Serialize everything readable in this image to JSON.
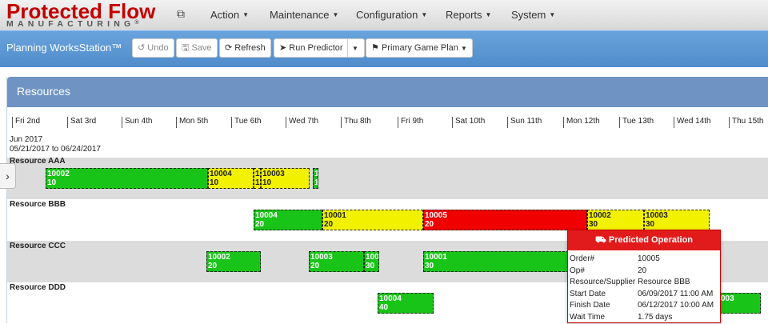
{
  "brand": {
    "name": "Protected Flow",
    "tagline": "MANUFACTURING",
    "trademark": "®"
  },
  "nav": {
    "items": [
      {
        "label": "Action"
      },
      {
        "label": "Maintenance"
      },
      {
        "label": "Configuration"
      },
      {
        "label": "Reports"
      },
      {
        "label": "System"
      }
    ],
    "expand_icon": "copy-icon"
  },
  "toolbar": {
    "title": "Planning WorksStation™",
    "undo": "Undo",
    "save": "Save",
    "refresh": "Refresh",
    "run_predictor": "Run Predictor",
    "primary_plan": "Primary Game Plan"
  },
  "resources": {
    "title": "Resources",
    "month": "Jun 2017",
    "range": "05/21/2017 to 06/24/2017",
    "days": [
      "Fri 2nd",
      "Sat 3rd",
      "Sun 4th",
      "Mon 5th",
      "Tue 6th",
      "Wed 7th",
      "Thu 8th",
      "Fri 9th",
      "Sat 10th",
      "Sun 11th",
      "Mon 12th",
      "Tue 13th",
      "Wed 14th",
      "Thu 15th"
    ],
    "rows": [
      {
        "name": "Resource AAA"
      },
      {
        "name": "Resource BBB"
      },
      {
        "name": "Resource CCC"
      },
      {
        "name": "Resource DDD"
      }
    ],
    "bars": [
      {
        "order": "10002",
        "op": "10"
      },
      {
        "order": "10004",
        "op": "10"
      },
      {
        "order": "1",
        "op": "1"
      },
      {
        "order": "10003",
        "op": "10"
      },
      {
        "order": "1",
        "op": "1"
      },
      {
        "order": "10004",
        "op": "20"
      },
      {
        "order": "10001",
        "op": "20"
      },
      {
        "order": "10005",
        "op": "20"
      },
      {
        "order": "10002",
        "op": "30"
      },
      {
        "order": "10003",
        "op": "30"
      },
      {
        "order": "10002",
        "op": "20"
      },
      {
        "order": "10003",
        "op": "20"
      },
      {
        "order": "100",
        "op": "30"
      },
      {
        "order": "10001",
        "op": "30"
      },
      {
        "order": "10004",
        "op": "40"
      },
      {
        "order": "003",
        "op": ""
      }
    ]
  },
  "popup": {
    "title": "Predicted Operation",
    "fields": [
      {
        "k": "Order#",
        "v": "10005"
      },
      {
        "k": "Op#",
        "v": "20"
      },
      {
        "k": "Resource/Supplier",
        "v": "Resource BBB"
      },
      {
        "k": "Start Date",
        "v": "06/09/2017 11:00 AM"
      },
      {
        "k": "Finish Date",
        "v": "06/12/2017 10:00 AM"
      },
      {
        "k": "Wait Time",
        "v": "1.75 days"
      }
    ]
  }
}
